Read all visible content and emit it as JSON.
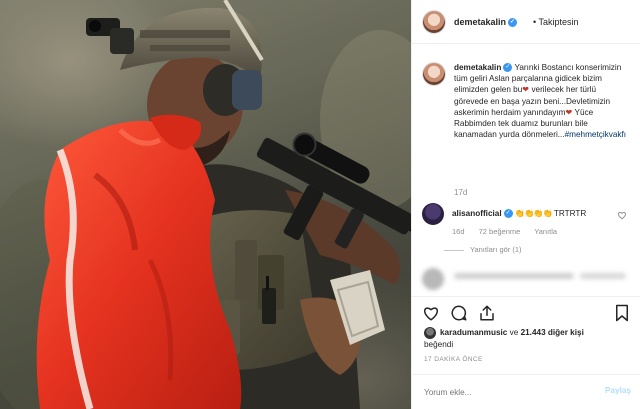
{
  "post": {
    "username": "demetakalin",
    "follow_status": "• Takiptesin",
    "verified_mark": "✓",
    "caption_parts": [
      "Yarınki Bostancı konserimizin tüm geliri Aslan parçalarına gidicek bizim elimizden gelen bu",
      "verilecek her türlü görevede en başa yazın beni...Devletimizin askerimin herdaim yanındayım",
      "Yüce Rabbimden tek duamız burunları bile kanamadan yurda dönmeleri..."
    ],
    "heart_emoji": "❤",
    "hashtag": "#mehmetçikvakfı",
    "caption_age": "17d"
  },
  "comment": {
    "username": "alisanofficial",
    "emojis": "👏👏👏👏",
    "text": "TRTRTR",
    "age": "16d",
    "likes": "72 beğenme",
    "reply": "Yanıtla",
    "view_replies": "Yanıtları gör (1)",
    "like_icon": "heart-outline-icon"
  },
  "likes": {
    "first_liker": "karadumanmusic",
    "connector": "ve",
    "others": "21.443 diğer kişi",
    "suffix": "beğendi"
  },
  "timestamp": "17 DAKİKA ÖNCE",
  "add_comment": {
    "placeholder": "Yorum ekle...",
    "post_button": "Paylaş"
  },
  "colors": {
    "accent": "#3897f0",
    "flag_red": "#e4321f",
    "post_button_disabled": "#b2dffc"
  }
}
